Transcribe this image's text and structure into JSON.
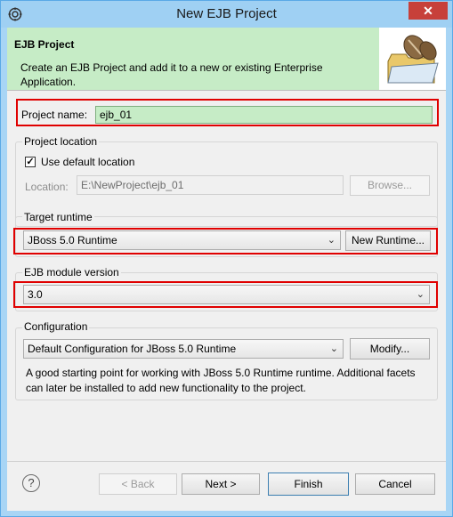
{
  "window": {
    "title": "New EJB Project",
    "close_glyph": "✕"
  },
  "banner": {
    "title": "EJB Project",
    "description": "Create an EJB Project and add it to a new or existing Enterprise Application.",
    "icon": "folder-with-bean-icon"
  },
  "project_name": {
    "label": "Project name:",
    "value": "ejb_01"
  },
  "project_location": {
    "legend": "Project location",
    "use_default_label": "Use default location",
    "use_default_checked": true,
    "location_label": "Location:",
    "location_value": "E:\\NewProject\\ejb_01",
    "browse_label": "Browse..."
  },
  "target_runtime": {
    "legend": "Target runtime",
    "selected": "JBoss 5.0 Runtime",
    "new_runtime_label": "New Runtime..."
  },
  "ejb_module_version": {
    "legend": "EJB module version",
    "selected": "3.0"
  },
  "configuration": {
    "legend": "Configuration",
    "selected": "Default Configuration for JBoss 5.0 Runtime",
    "modify_label": "Modify...",
    "description": "A good starting point for working with JBoss 5.0 Runtime runtime. Additional facets can later be installed to add new functionality to the project."
  },
  "footer": {
    "help_glyph": "?",
    "back_label": "< Back",
    "next_label": "Next >",
    "finish_label": "Finish",
    "cancel_label": "Cancel"
  },
  "colors": {
    "highlight": "#e00000",
    "banner_bg": "#c6ecc6",
    "input_bg": "#c6ecc6",
    "titlebar": "#9fd0f3",
    "close": "#c7403a"
  }
}
